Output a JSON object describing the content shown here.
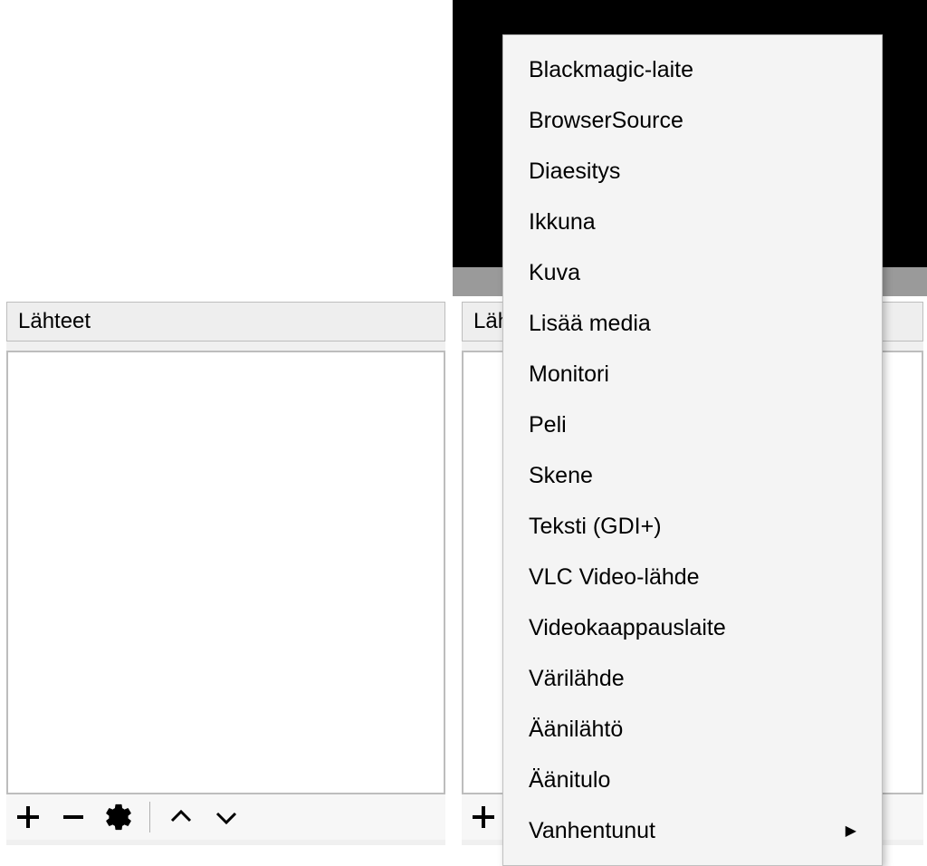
{
  "panel_left": {
    "title": "Lähteet"
  },
  "panel_right": {
    "title": "Läh"
  },
  "context_menu": {
    "items": [
      {
        "label": "Blackmagic-laite",
        "has_submenu": false
      },
      {
        "label": "BrowserSource",
        "has_submenu": false
      },
      {
        "label": "Diaesitys",
        "has_submenu": false
      },
      {
        "label": "Ikkuna",
        "has_submenu": false
      },
      {
        "label": "Kuva",
        "has_submenu": false
      },
      {
        "label": "Lisää media",
        "has_submenu": false
      },
      {
        "label": "Monitori",
        "has_submenu": false
      },
      {
        "label": "Peli",
        "has_submenu": false
      },
      {
        "label": "Skene",
        "has_submenu": false
      },
      {
        "label": "Teksti (GDI+)",
        "has_submenu": false
      },
      {
        "label": "VLC Video-lähde",
        "has_submenu": false
      },
      {
        "label": "Videokaappauslaite",
        "has_submenu": false
      },
      {
        "label": "Värilähde",
        "has_submenu": false
      },
      {
        "label": "Äänilähtö",
        "has_submenu": false
      },
      {
        "label": "Äänitulo",
        "has_submenu": false
      },
      {
        "label": "Vanhentunut",
        "has_submenu": true
      }
    ]
  }
}
